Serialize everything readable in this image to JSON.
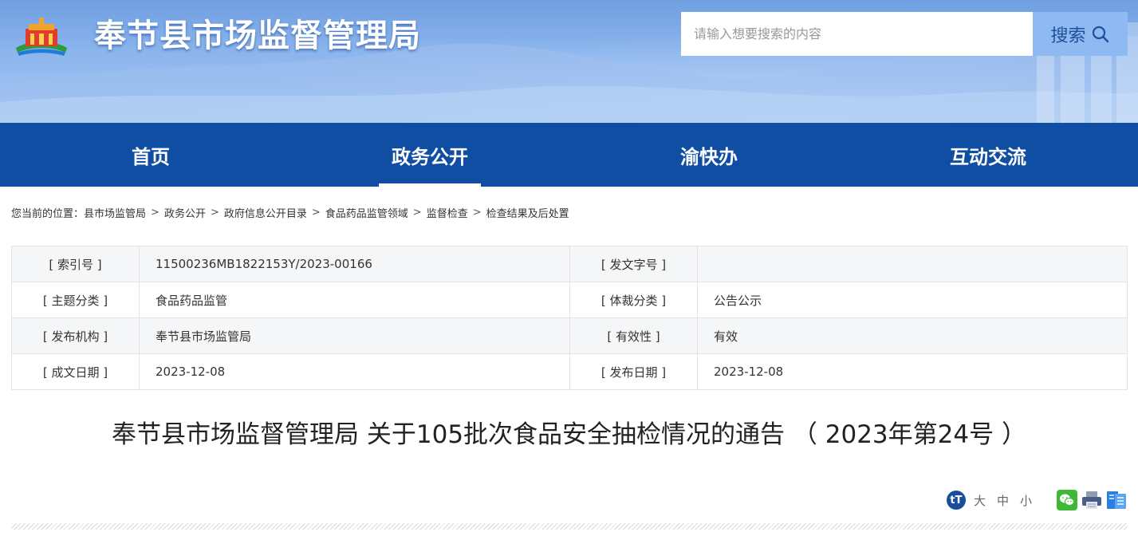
{
  "header": {
    "site_title": "奉节县市场监督管理局",
    "search_placeholder": "请输入想要搜索的内容",
    "search_button": "搜索"
  },
  "nav": {
    "items": [
      {
        "label": "首页"
      },
      {
        "label": "政务公开",
        "active": true
      },
      {
        "label": "渝快办"
      },
      {
        "label": "互动交流"
      }
    ]
  },
  "breadcrumb": {
    "prefix": "您当前的位置：",
    "items": [
      "县市场监管局",
      "政务公开",
      "政府信息公开目录",
      "食品药品监管领域",
      "监督检查",
      "检查结果及后处置"
    ],
    "separator": ">"
  },
  "info": {
    "rows": [
      {
        "label1": "[ 索引号 ]",
        "value1": "11500236MB1822153Y/2023-00166",
        "label2": "[ 发文字号 ]",
        "value2": ""
      },
      {
        "label1": "[ 主题分类 ]",
        "value1": "食品药品监管",
        "label2": "[ 体裁分类 ]",
        "value2": "公告公示"
      },
      {
        "label1": "[ 发布机构 ]",
        "value1": "奉节县市场监管局",
        "label2": "[ 有效性 ]",
        "value2": "有效"
      },
      {
        "label1": "[ 成文日期 ]",
        "value1": "2023-12-08",
        "label2": "[ 发布日期 ]",
        "value2": "2023-12-08"
      }
    ]
  },
  "article": {
    "title": "奉节县市场监督管理局 关于105批次食品安全抽检情况的通告 （ 2023年第24号 ）"
  },
  "tools": {
    "font_icon_text": "tT",
    "size_large": "大",
    "size_medium": "中",
    "size_small": "小"
  },
  "colors": {
    "nav_bg": "#0f4ea3",
    "header_bg": "#8db6ee",
    "search_btn_bg": "#8fb9f1"
  }
}
